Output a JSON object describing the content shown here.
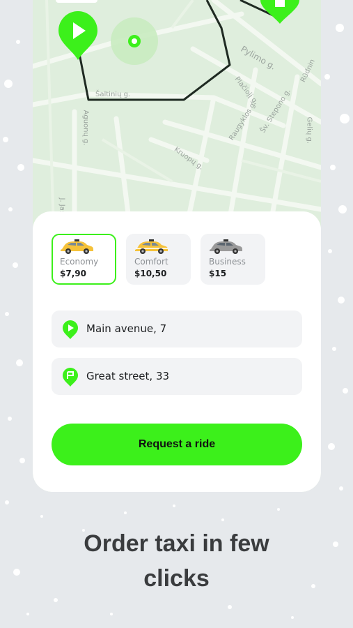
{
  "map": {
    "street_labels": [
      "Pylimo g.",
      "Plačiojį g.",
      "Raugyklos g.",
      "Šv. Stepono g.",
      "Šaltinių g.",
      "Aguonų g.",
      "Kruopų g.",
      "J. Jasinskio g.",
      "Rūdnin",
      "Gelių g."
    ]
  },
  "cars": [
    {
      "name": "Economy",
      "price": "$7,90",
      "color": "#f5c23a",
      "selected": true
    },
    {
      "name": "Comfort",
      "price": "$10,50",
      "color": "#f5c23a",
      "selected": false
    },
    {
      "name": "Business",
      "price": "$15",
      "color": "#9a9a9a",
      "selected": false
    }
  ],
  "route": {
    "from": "Main avenue, 7",
    "to": "Great street, 33"
  },
  "request_button": "Request a ride",
  "caption": {
    "line1": "Order taxi in few",
    "line2": "clicks"
  },
  "colors": {
    "accent": "#3cf01b",
    "map_background": "#dfeedd",
    "route_line": "#1f2a22"
  }
}
